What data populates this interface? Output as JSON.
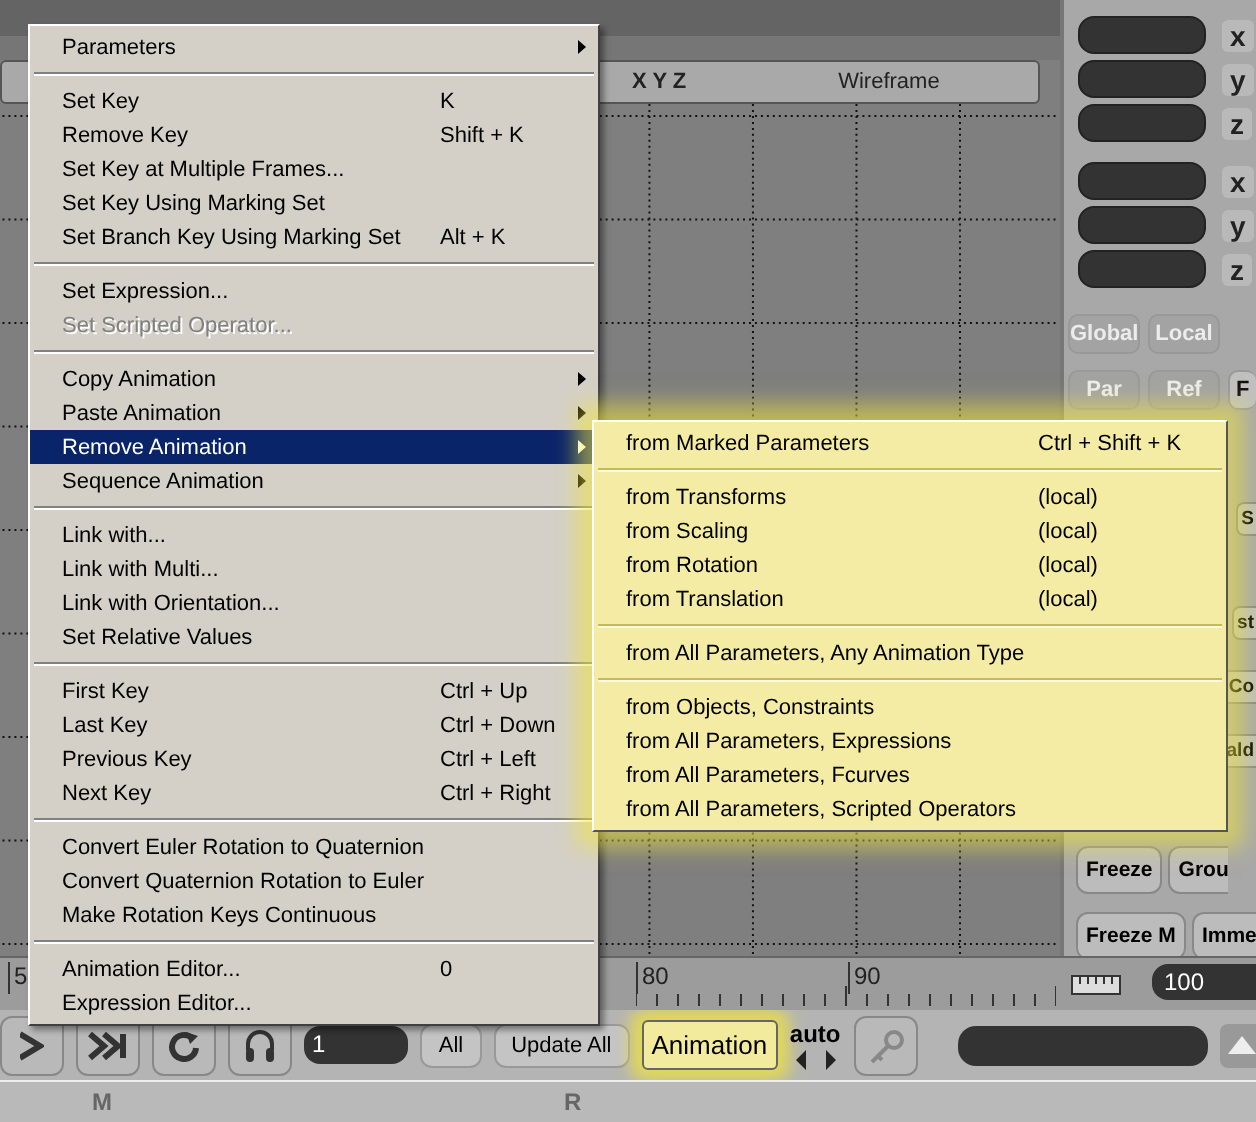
{
  "viewport": {
    "axes": "X Y Z",
    "mode": "Wireframe"
  },
  "side_panel": {
    "fields": [
      {
        "axis": "x"
      },
      {
        "axis": "y"
      },
      {
        "axis": "z"
      },
      {
        "axis": "x"
      },
      {
        "axis": "y"
      },
      {
        "axis": "z"
      }
    ],
    "button_rows": [
      [
        "Global",
        "Local"
      ],
      [
        "Par",
        "Ref",
        "F"
      ]
    ],
    "cut_buttons": [
      "S",
      "st",
      "Co",
      "ald"
    ],
    "bottom_rows": [
      [
        "Freeze",
        "Grou"
      ],
      [
        "Freeze M",
        "Imme"
      ]
    ]
  },
  "timeline": {
    "ticks": [
      "5",
      "80",
      "90"
    ],
    "end_frame": "100"
  },
  "toolbar": {
    "frame": "1",
    "all": "All",
    "update": "Update All",
    "mode": "Animation",
    "mode_highlighted": true,
    "auto": "auto"
  },
  "bottom_strip": [
    "M",
    "R"
  ],
  "context_menu": {
    "groups": [
      [
        {
          "label": "Parameters",
          "submenu": true,
          "disabled": false,
          "selected": false
        }
      ],
      [
        {
          "label": "Set Key",
          "shortcut": "K",
          "submenu": false,
          "disabled": false,
          "selected": false
        },
        {
          "label": "Remove Key",
          "shortcut": "Shift + K",
          "submenu": false,
          "disabled": false,
          "selected": false
        },
        {
          "label": "Set Key at Multiple Frames...",
          "submenu": false,
          "disabled": false,
          "selected": false
        },
        {
          "label": "Set Key Using Marking Set",
          "submenu": false,
          "disabled": false,
          "selected": false
        },
        {
          "label": "Set Branch Key Using Marking Set",
          "shortcut": "Alt + K",
          "submenu": false,
          "disabled": false,
          "selected": false
        }
      ],
      [
        {
          "label": "Set Expression...",
          "submenu": false,
          "disabled": false,
          "selected": false
        },
        {
          "label": "Set Scripted Operator...",
          "submenu": false,
          "disabled": true,
          "selected": false
        }
      ],
      [
        {
          "label": "Copy Animation",
          "submenu": true,
          "disabled": false,
          "selected": false
        },
        {
          "label": "Paste Animation",
          "submenu": true,
          "disabled": false,
          "selected": false
        },
        {
          "label": "Remove Animation",
          "submenu": true,
          "disabled": false,
          "selected": true
        },
        {
          "label": "Sequence Animation",
          "submenu": true,
          "disabled": false,
          "selected": false
        }
      ],
      [
        {
          "label": "Link with...",
          "submenu": false,
          "disabled": false,
          "selected": false
        },
        {
          "label": "Link with Multi...",
          "submenu": false,
          "disabled": false,
          "selected": false
        },
        {
          "label": "Link with Orientation...",
          "submenu": false,
          "disabled": false,
          "selected": false
        },
        {
          "label": "Set Relative Values",
          "submenu": false,
          "disabled": false,
          "selected": false
        }
      ],
      [
        {
          "label": "First Key",
          "shortcut": "Ctrl + Up",
          "submenu": false,
          "disabled": false,
          "selected": false
        },
        {
          "label": "Last Key",
          "shortcut": "Ctrl + Down",
          "submenu": false,
          "disabled": false,
          "selected": false
        },
        {
          "label": "Previous Key",
          "shortcut": "Ctrl + Left",
          "submenu": false,
          "disabled": false,
          "selected": false
        },
        {
          "label": "Next Key",
          "shortcut": "Ctrl + Right",
          "submenu": false,
          "disabled": false,
          "selected": false
        }
      ],
      [
        {
          "label": "Convert Euler Rotation to Quaternion",
          "submenu": false,
          "disabled": false,
          "selected": false
        },
        {
          "label": "Convert Quaternion Rotation to Euler",
          "submenu": false,
          "disabled": false,
          "selected": false
        },
        {
          "label": "Make Rotation Keys Continuous",
          "submenu": false,
          "disabled": false,
          "selected": false
        }
      ],
      [
        {
          "label": "Animation Editor...",
          "shortcut": "0",
          "submenu": false,
          "disabled": false,
          "selected": false
        },
        {
          "label": "Expression Editor...",
          "submenu": false,
          "disabled": false,
          "selected": false
        }
      ]
    ]
  },
  "submenu": {
    "groups": [
      [
        {
          "label": "from Marked Parameters",
          "shortcut": "Ctrl + Shift + K"
        }
      ],
      [
        {
          "label": "from Transforms",
          "shortcut": "(local)"
        },
        {
          "label": "from Scaling",
          "shortcut": "(local)"
        },
        {
          "label": "from Rotation",
          "shortcut": "(local)"
        },
        {
          "label": "from Translation",
          "shortcut": "(local)"
        }
      ],
      [
        {
          "label": "from All Parameters, Any Animation Type"
        }
      ],
      [
        {
          "label": "from Objects, Constraints"
        },
        {
          "label": "from All Parameters, Expressions"
        },
        {
          "label": "from All Parameters, Fcurves"
        },
        {
          "label": "from All Parameters, Scripted Operators"
        }
      ]
    ]
  }
}
